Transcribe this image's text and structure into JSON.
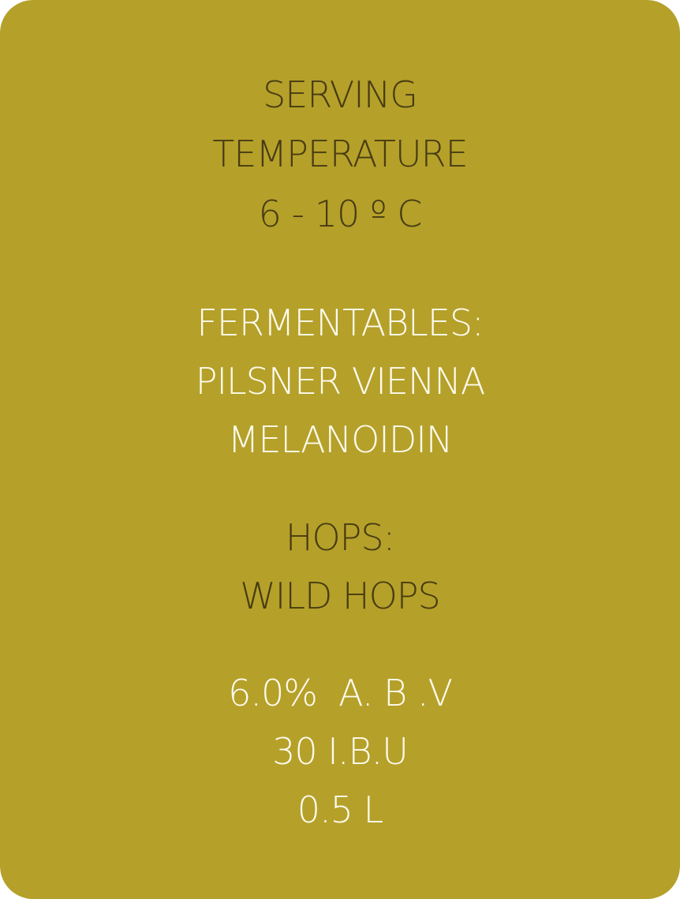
{
  "colors": {
    "card_background": "#b5a02a",
    "dark_text": "#473c12",
    "light_text": "#fdfbef"
  },
  "serving": {
    "line1": "SERVING",
    "line2": "TEMPERATURE",
    "temperature": "6 - 10 º C"
  },
  "fermentables": {
    "heading": "FERMENTABLES:",
    "line1": "PILSNER VIENNA",
    "line2": "MELANOIDIN"
  },
  "hops": {
    "heading": "HOPS:",
    "value": "WILD HOPS"
  },
  "specs": {
    "abv": "6.0%  A. B .V",
    "ibu": "30 I.B.U",
    "volume": "0.5 L"
  }
}
